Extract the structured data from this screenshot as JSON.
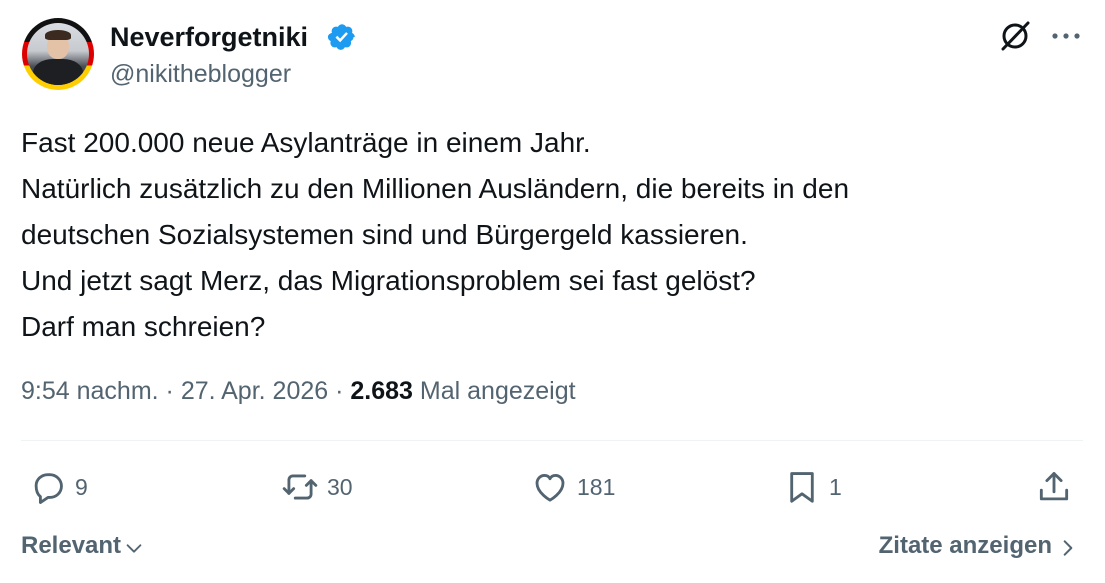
{
  "author": {
    "display_name": "Neverforgetniki",
    "handle": "@nikitheblogger",
    "verified": true
  },
  "tweet": {
    "lines": [
      "Fast 200.000 neue Asylanträge in einem Jahr.",
      "Natürlich zusätzlich zu den Millionen Ausländern, die bereits in den",
      "deutschen Sozialsystemen sind und Bürgergeld kassieren.",
      "Und jetzt sagt Merz, das Migrationsproblem sei fast gelöst?",
      "Darf man schreien?"
    ]
  },
  "meta": {
    "time": "9:54 nachm.",
    "separator": " · ",
    "date": "27. Apr. 2026",
    "views_count": "2.683",
    "views_label": "Mal angezeigt"
  },
  "actions": {
    "replies": "9",
    "reposts": "30",
    "likes": "181",
    "bookmarks": "1"
  },
  "footer": {
    "sort_label": "Relevant",
    "quotes_label": "Zitate anzeigen"
  },
  "colors": {
    "text": "#0f1419",
    "secondary": "#536471",
    "verified": "#1d9bf0",
    "divider": "#eff3f4"
  },
  "icons": [
    "grok-icon",
    "more-icon",
    "reply-icon",
    "repost-icon",
    "like-icon",
    "bookmark-icon",
    "share-icon",
    "chevron-down-icon",
    "chevron-right-icon",
    "verified-badge-icon"
  ]
}
